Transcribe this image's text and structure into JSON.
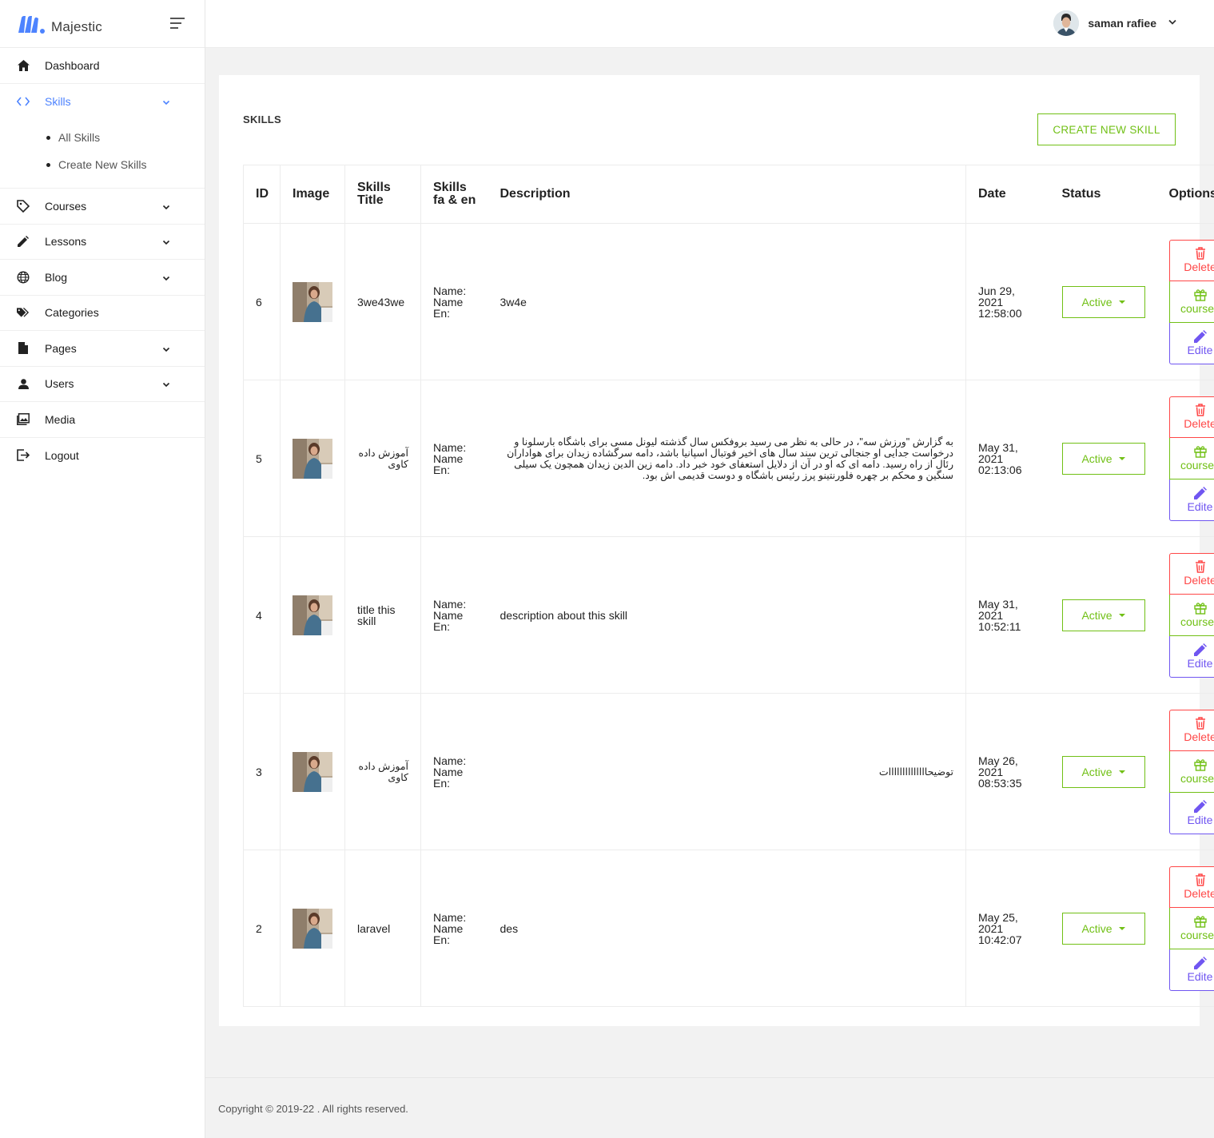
{
  "brand": {
    "name": "Majestic",
    "accent": "#4d83ff"
  },
  "sidebar": {
    "items": [
      {
        "label": "Dashboard",
        "icon": "home-icon",
        "has_submenu": false
      },
      {
        "label": "Skills",
        "icon": "code-icon",
        "has_submenu": true,
        "active": true,
        "subitems": [
          {
            "label": "All Skills"
          },
          {
            "label": "Create New Skills"
          }
        ]
      },
      {
        "label": "Courses",
        "icon": "tag-icon",
        "has_submenu": true
      },
      {
        "label": "Lessons",
        "icon": "pencil-icon",
        "has_submenu": true
      },
      {
        "label": "Blog",
        "icon": "globe-icon",
        "has_submenu": true
      },
      {
        "label": "Categories",
        "icon": "tags-icon",
        "has_submenu": false
      },
      {
        "label": "Pages",
        "icon": "file-icon",
        "has_submenu": true
      },
      {
        "label": "Users",
        "icon": "user-icon",
        "has_submenu": true
      },
      {
        "label": "Media",
        "icon": "image-icon",
        "has_submenu": false
      },
      {
        "label": "Logout",
        "icon": "logout-icon",
        "has_submenu": false
      }
    ]
  },
  "topbar": {
    "user_name": "saman rafiee"
  },
  "page": {
    "title": "SKILLS",
    "create_label": "CREATE NEW SKILL"
  },
  "table": {
    "headers": {
      "id": "ID",
      "image": "Image",
      "title_1": "Skills",
      "title_2": "Title",
      "lang_1": "Skills",
      "lang_2": "fa & en",
      "description": "Description",
      "date": "Date",
      "status": "Status",
      "options": "Options"
    },
    "rows": [
      {
        "id": "6",
        "title": "3we43we",
        "title_rtl": false,
        "name_label": "Name:",
        "name_en_1": "Name",
        "name_en_2": "En:",
        "description": "3w4e",
        "desc_rtl": false,
        "date_1": "Jun 29,",
        "date_2": "2021",
        "date_3": "12:58:00",
        "status": "Active"
      },
      {
        "id": "5",
        "title": "آموزش داده کاوی",
        "title_rtl": true,
        "name_label": "Name:",
        "name_en_1": "Name",
        "name_en_2": "En:",
        "description": "به گزارش \"ورزش سه\"، در حالی به نظر می رسید بروفکس سال گذشته لیونل مسی برای باشگاه بارسلونا و درخواست جدایی او جنجالی ترین سند سال های اخیر فوتبال اسپانیا باشد، دامه سرگشاده زیدان برای هواداران رئال از راه رسید. دامه ای که او در آن از دلایل استعفای خود خبر داد. دامه زین الدین زیدان همچون یک سیلی سنگین و محکم بر چهره فلورنتینو پرز رئیس باشگاه و دوست قدیمی اش بود.",
        "desc_rtl": true,
        "date_1": "May 31,",
        "date_2": "2021",
        "date_3": "02:13:06",
        "status": "Active"
      },
      {
        "id": "4",
        "title": "title this skill",
        "title_rtl": false,
        "name_label": "Name:",
        "name_en_1": "Name",
        "name_en_2": "En:",
        "description": "description about this skill",
        "desc_rtl": false,
        "date_1": "May 31,",
        "date_2": "2021",
        "date_3": "10:52:11",
        "status": "Active"
      },
      {
        "id": "3",
        "title": "آموزش داده کاوی",
        "title_rtl": true,
        "name_label": "Name:",
        "name_en_1": "Name",
        "name_en_2": "En:",
        "description": "توضیحاااااااااااااات",
        "desc_rtl": true,
        "date_1": "May 26,",
        "date_2": "2021",
        "date_3": "08:53:35",
        "status": "Active"
      },
      {
        "id": "2",
        "title": "laravel",
        "title_rtl": false,
        "name_label": "Name:",
        "name_en_1": "Name",
        "name_en_2": "En:",
        "description": "des",
        "desc_rtl": false,
        "date_1": "May 25,",
        "date_2": "2021",
        "date_3": "10:42:07",
        "status": "Active"
      }
    ],
    "options": {
      "delete": "Delete",
      "courses": "courses",
      "edit": "Edite"
    }
  },
  "colors": {
    "green": "#71c016",
    "red": "#ff4747",
    "purple": "#7056f1",
    "blue": "#4d83ff"
  },
  "footer": {
    "text": "Copyright © 2019-22 . All rights reserved."
  }
}
